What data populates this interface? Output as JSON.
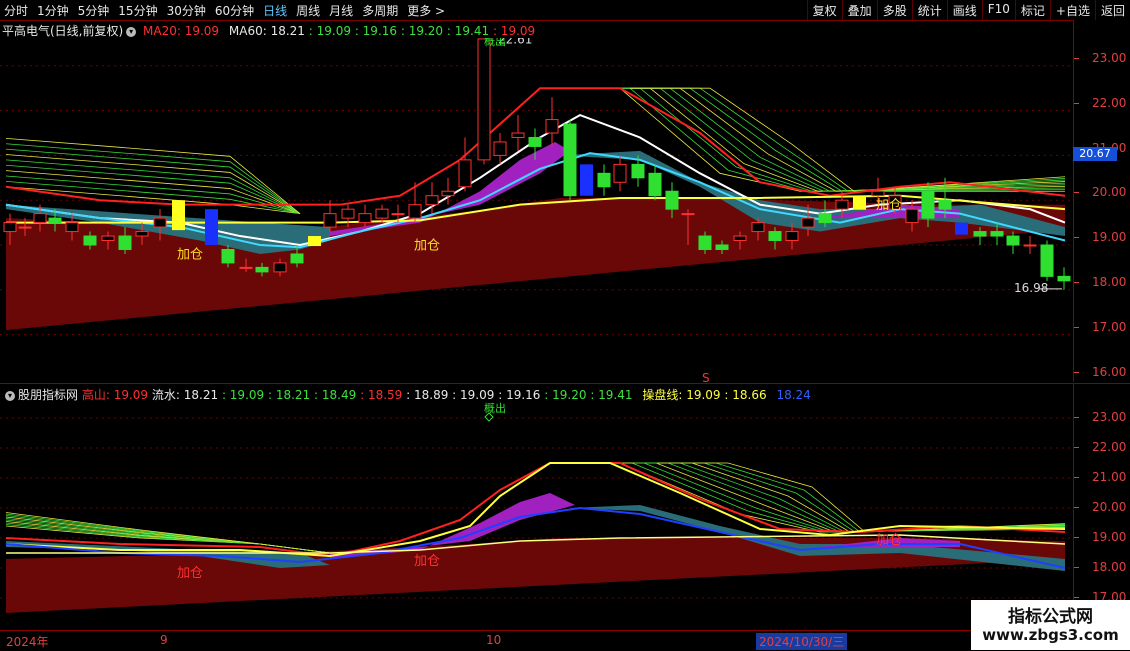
{
  "toolbar": {
    "periods": [
      "分时",
      "1分钟",
      "5分钟",
      "15分钟",
      "30分钟",
      "60分钟",
      "日线",
      "周线",
      "月线",
      "多周期",
      "更多 >"
    ],
    "active_period": "日线",
    "actions": [
      "复权",
      "叠加",
      "多股",
      "统计",
      "画线",
      "F10",
      "标记",
      "+自选",
      "返回"
    ]
  },
  "main_header": {
    "title": "平高电气(日线,前复权)",
    "ma20_label": "MA20: 19.09",
    "ma60_label": "MA60: 18.21",
    "values": [
      ": 19.09",
      ": 19.16",
      ": 19.20",
      ": 19.41",
      ": 19.09"
    ]
  },
  "sub_header": {
    "title": "股朋指标网",
    "gaoshan_label": "高山: 19.09",
    "liushui_label": "流水: 18.21",
    "values": [
      ": 19.09",
      ": 18.21",
      ": 18.49",
      ": 18.59",
      ": 18.89",
      ": 19.09",
      ": 19.16",
      ": 19.20",
      ": 19.41"
    ],
    "caopan_label": "操盘线: 19.09",
    "caopan_extra": ": 18.66",
    "blue_value": "18.24"
  },
  "main_axis": [
    "23.00",
    "22.00",
    "21.00",
    "20.00",
    "19.00",
    "18.00",
    "17.00",
    "16.00"
  ],
  "sub_axis": [
    "23.00",
    "22.00",
    "21.00",
    "20.00",
    "19.00",
    "18.00",
    "17.00"
  ],
  "current_price": "20.67",
  "annotations": {
    "high": "22.61",
    "low": "16.98",
    "add_label": "加仓",
    "top_label": "概出",
    "s_mark": "S"
  },
  "date_axis": {
    "labels": [
      "2024年",
      "9",
      "10"
    ],
    "selected_date": "2024/10/30/三"
  },
  "watermark": {
    "line1": "指标公式网",
    "line2": "www.zbgs3.com"
  },
  "colors": {
    "up": "#ff3030",
    "down": "#30e030",
    "ma_red": "#ff2020",
    "ma_white": "#ffffff",
    "ma_cyan": "#40d8ff",
    "ma_yellow": "#ffff40",
    "band_purple": "#a020c0",
    "band_teal": "#2a6c78",
    "band_maroon": "#6a0808"
  }
}
